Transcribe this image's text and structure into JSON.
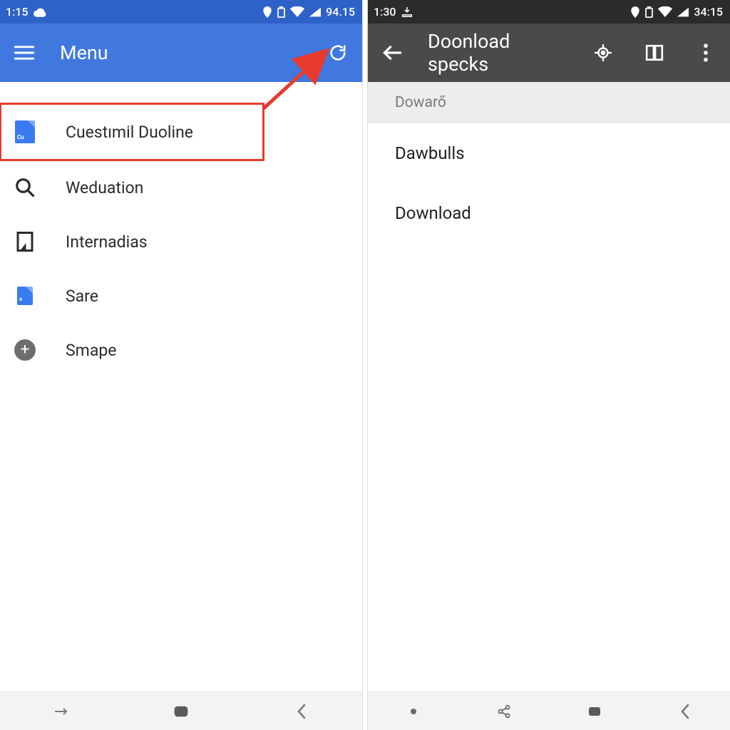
{
  "left": {
    "statusbar": {
      "time": "1:15",
      "battery": "94.15"
    },
    "appbar": {
      "title": "Menu"
    },
    "menu": [
      {
        "id": "cuestimil-duoline",
        "label": "Cuestımil Duoline",
        "highlighted": true
      },
      {
        "id": "wequation",
        "label": "Weduation"
      },
      {
        "id": "internadias",
        "label": "Internadias"
      },
      {
        "id": "sare",
        "label": "Sare"
      },
      {
        "id": "smape",
        "label": "Smape"
      }
    ]
  },
  "right": {
    "statusbar": {
      "time": "1:30",
      "battery": "34:15"
    },
    "appbar": {
      "title": "Doonload specks"
    },
    "section_header": "Dowarő",
    "items": [
      {
        "id": "dawbulls",
        "label": "Dawbulls"
      },
      {
        "id": "download",
        "label": "Download"
      }
    ]
  }
}
